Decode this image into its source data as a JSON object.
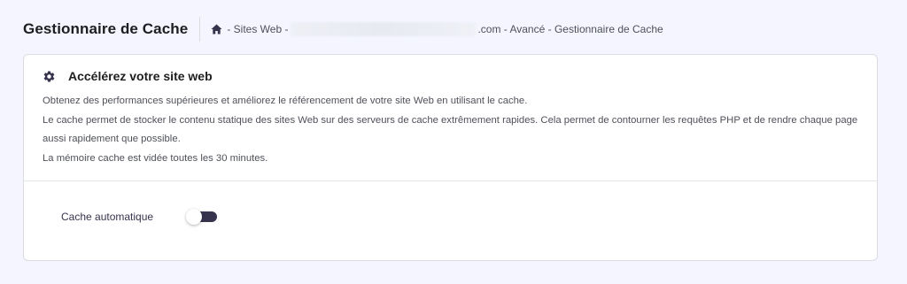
{
  "header": {
    "title": "Gestionnaire de Cache",
    "breadcrumb": {
      "home_icon": "home-icon",
      "prefix": "- Sites Web -",
      "suffix": ".com - Avancé - Gestionnaire de Cache"
    }
  },
  "card": {
    "icon": "gear-icon",
    "title": "Accélérez votre site web",
    "description": [
      "Obtenez des performances supérieures et améliorez le référencement de votre site Web en utilisant le cache.",
      "Le cache permet de stocker le contenu statique des sites Web sur des serveurs de cache extrêmement rapides. Cela permet de contourner les requêtes PHP et de rendre chaque page aussi rapidement que possible.",
      "La mémoire cache est vidée toutes les 30 minutes."
    ],
    "toggle": {
      "label": "Cache automatique",
      "enabled": false
    }
  },
  "colors": {
    "background": "#f4f5ff",
    "card": "#ffffff",
    "toggle_track": "#36344d"
  }
}
